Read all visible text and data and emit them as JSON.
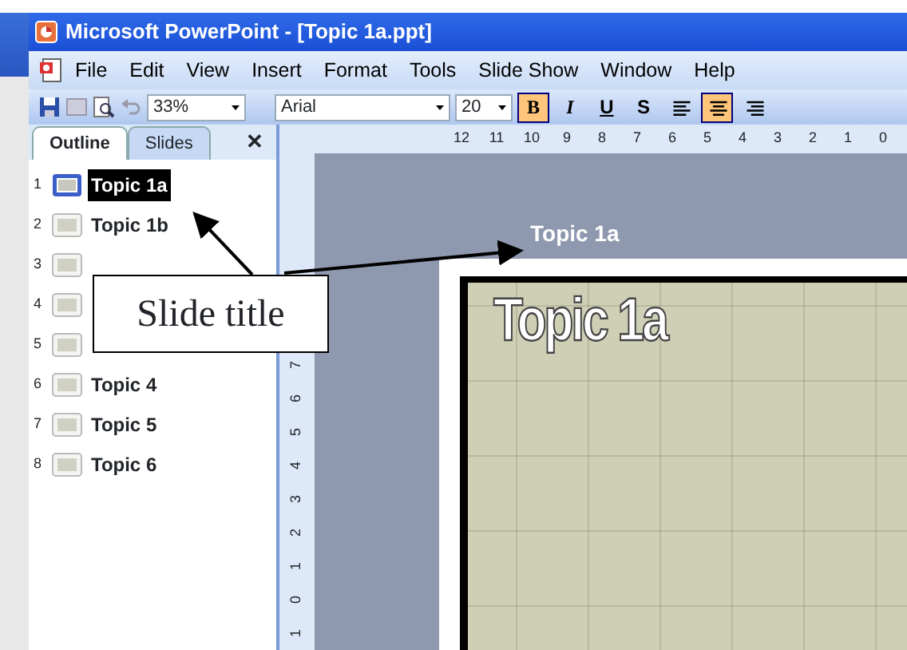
{
  "window": {
    "title": "Microsoft PowerPoint - [Topic 1a.ppt]"
  },
  "menu": [
    {
      "label": "File"
    },
    {
      "label": "Edit"
    },
    {
      "label": "View"
    },
    {
      "label": "Insert"
    },
    {
      "label": "Format"
    },
    {
      "label": "Tools"
    },
    {
      "label": "Slide Show"
    },
    {
      "label": "Window"
    },
    {
      "label": "Help"
    }
  ],
  "toolbar": {
    "zoom": "33%",
    "font": "Arial",
    "size": "20",
    "format_buttons": [
      {
        "label": "B",
        "selected": true
      },
      {
        "label": "I",
        "selected": false
      },
      {
        "label": "U",
        "selected": false
      },
      {
        "label": "S",
        "selected": false
      }
    ],
    "align_buttons": [
      {
        "selected": false
      },
      {
        "selected": true
      },
      {
        "selected": false
      }
    ]
  },
  "pane": {
    "tabs": [
      {
        "label": "Outline",
        "selected": true
      },
      {
        "label": "Slides",
        "selected": false
      }
    ],
    "close": "✕",
    "slides": [
      {
        "number": "1",
        "label": "Topic 1a",
        "selected": true
      },
      {
        "number": "2",
        "label": "Topic 1b",
        "selected": false
      },
      {
        "number": "3",
        "selected": false
      },
      {
        "number": "4",
        "selected": false
      },
      {
        "number": "5",
        "selected": false
      },
      {
        "number": "6",
        "label": "Topic 4",
        "selected": false
      },
      {
        "number": "7",
        "label": "Topic 5",
        "selected": false
      },
      {
        "number": "8",
        "label": "Topic 6",
        "selected": false
      }
    ]
  },
  "ruler": {
    "horizontal": [
      "12",
      "11",
      "10",
      "9",
      "8",
      "7",
      "6",
      "5",
      "4",
      "3",
      "2",
      "1",
      "0"
    ],
    "vertical": [
      "7",
      "6",
      "5",
      "4",
      "3",
      "2",
      "1",
      "0",
      "1"
    ]
  },
  "slide_tag": "Topic 1a",
  "slide": {
    "title": "Topic 1a"
  },
  "callout": {
    "text": "Slide title"
  }
}
